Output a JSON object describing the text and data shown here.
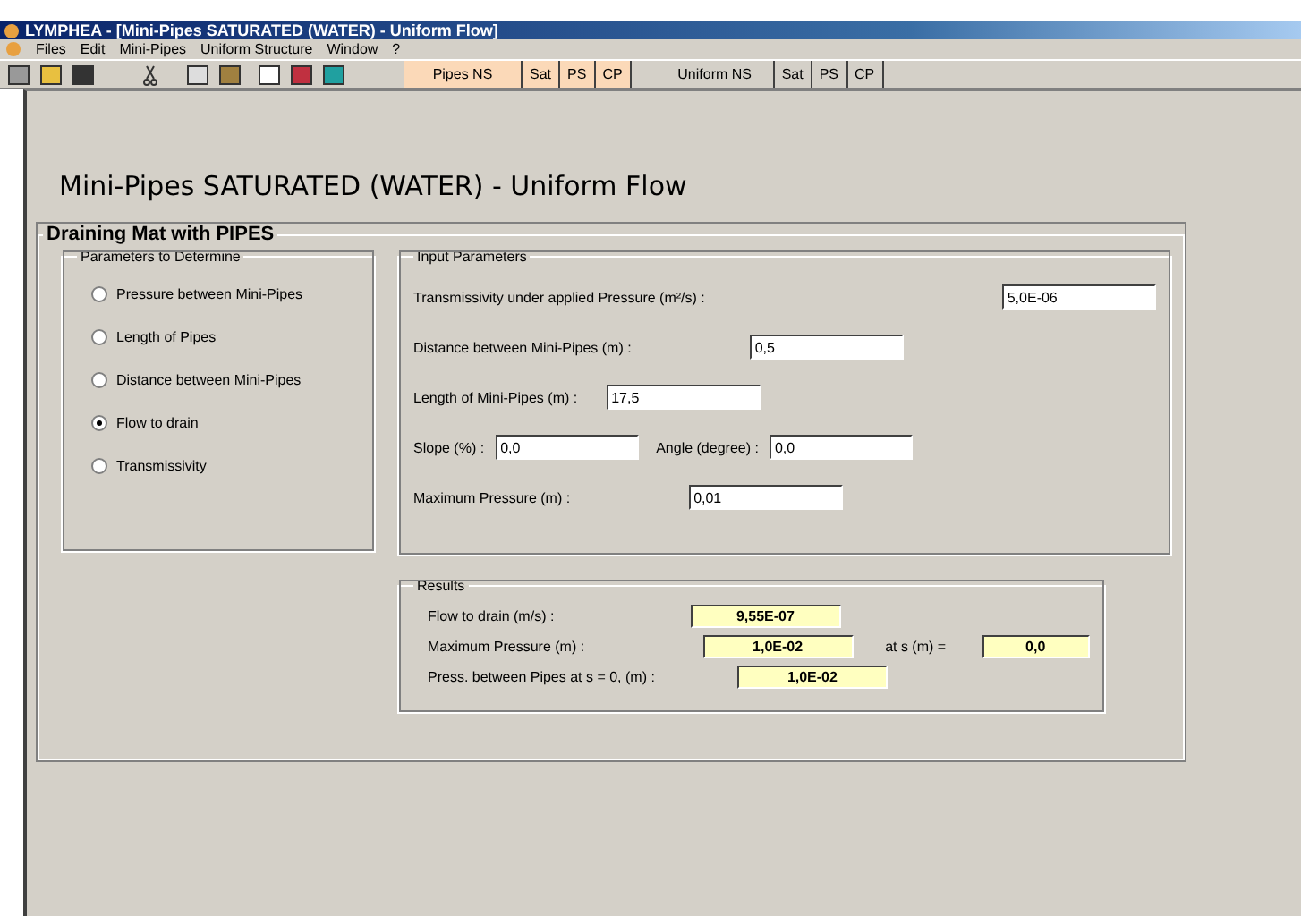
{
  "window": {
    "title": "LYMPHEA - [Mini-Pipes SATURATED (WATER) - Uniform Flow]"
  },
  "menu": [
    "Files",
    "Edit",
    "Mini-Pipes",
    "Uniform Structure",
    "Window",
    "?"
  ],
  "toolbar_tabs": [
    {
      "label": "Pipes NS",
      "selected": true
    },
    {
      "label": "Sat",
      "selected": true
    },
    {
      "label": "PS",
      "selected": true
    },
    {
      "label": "CP",
      "selected": true
    },
    {
      "label": "Uniform NS",
      "selected": false
    },
    {
      "label": "Sat",
      "selected": false
    },
    {
      "label": "PS",
      "selected": false
    },
    {
      "label": "CP",
      "selected": false
    }
  ],
  "heading": "Mini-Pipes SATURATED (WATER) - Uniform Flow",
  "group_title": "Draining Mat with PIPES",
  "parameters": {
    "title": "Parameters to Determine",
    "options": [
      {
        "label": "Pressure between Mini-Pipes",
        "selected": false
      },
      {
        "label": "Length of Pipes",
        "selected": false
      },
      {
        "label": "Distance between Mini-Pipes",
        "selected": false
      },
      {
        "label": "Flow to drain",
        "selected": true
      },
      {
        "label": "Transmissivity",
        "selected": false
      }
    ]
  },
  "inputs": {
    "title": "Input Parameters",
    "rows": [
      [
        {
          "label": "Transmissivity under applied Pressure (m²/s) :",
          "value": "5,0E-06"
        }
      ],
      [
        {
          "label": "Distance between Mini-Pipes (m) :",
          "value": "0,5"
        }
      ],
      [
        {
          "label": "Length of Mini-Pipes (m) :",
          "value": "17,5"
        }
      ],
      [
        {
          "label": "Slope (%) :",
          "value": "0,0"
        },
        {
          "label": "Angle (degree) :",
          "value": "0,0"
        }
      ],
      [
        {
          "label": "Maximum Pressure (m) :",
          "value": "0,01"
        }
      ]
    ]
  },
  "results": {
    "title": "Results",
    "rows": [
      [
        {
          "label": "Flow to drain (m/s) :",
          "value": "9,55E-07"
        }
      ],
      [
        {
          "label": "Maximum Pressure (m) :",
          "value": "1,0E-02"
        },
        {
          "label": "at s (m) =",
          "value": "0,0"
        }
      ],
      [
        {
          "label": "Press. between Pipes at s = 0, (m) :",
          "value": "1,0E-02"
        }
      ]
    ]
  }
}
